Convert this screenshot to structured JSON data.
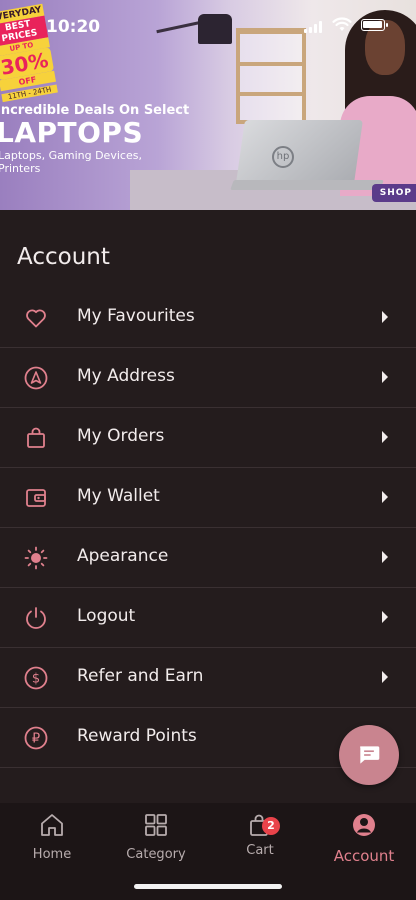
{
  "status_bar": {
    "time": "10:20",
    "battery_percent": 90
  },
  "banner": {
    "badge_top": "EVERYDAY",
    "badge_sub": "BEST PRICES",
    "badge_upto": "UP TO",
    "badge_percent": "30%",
    "badge_off": "OFF",
    "badge_dates": "11TH - 24TH",
    "heading": "Incredible Deals On Select",
    "big_text": "LAPTOPS",
    "sub_line1": "Laptops, Gaming Devices,",
    "sub_line2": "Printers",
    "shop_button": "SHOP",
    "laptop_logo": "hp"
  },
  "account": {
    "title": "Account",
    "items": [
      {
        "label": "My Favourites",
        "icon": "heart-icon"
      },
      {
        "label": "My Address",
        "icon": "navigation-arrow-icon"
      },
      {
        "label": "My Orders",
        "icon": "shopping-bag-icon"
      },
      {
        "label": "My Wallet",
        "icon": "wallet-icon"
      },
      {
        "label": "Apearance",
        "icon": "sun-icon"
      },
      {
        "label": "Logout",
        "icon": "power-icon"
      },
      {
        "label": "Refer and Earn",
        "icon": "dollar-icon"
      },
      {
        "label": "Reward Points",
        "icon": "ruble-icon"
      }
    ]
  },
  "bottom_nav": {
    "items": [
      {
        "label": "Home",
        "icon": "home-icon"
      },
      {
        "label": "Category",
        "icon": "grid-icon"
      },
      {
        "label": "Cart",
        "icon": "cart-bag-icon",
        "badge": "2"
      },
      {
        "label": "Account",
        "icon": "account-icon",
        "active": true
      }
    ]
  },
  "colors": {
    "accent": "#e0808d",
    "background": "#241c1d",
    "fab": "#c9848f"
  }
}
